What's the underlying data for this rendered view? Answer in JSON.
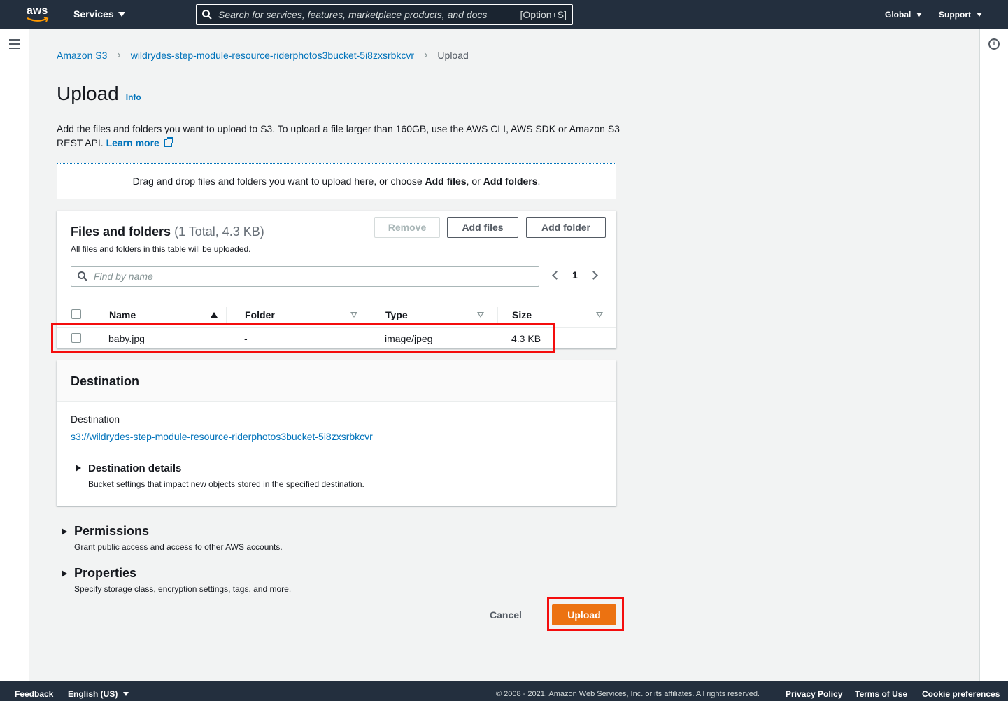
{
  "topnav": {
    "logo_text": "aws",
    "services_label": "Services",
    "search_placeholder": "Search for services, features, marketplace products, and docs",
    "search_shortcut": "[Option+S]",
    "region_label": "Global",
    "support_label": "Support"
  },
  "breadcrumb": {
    "root": "Amazon S3",
    "bucket": "wildrydes-step-module-resource-riderphotos3bucket-5i8zxsrbkcvr",
    "current": "Upload"
  },
  "page": {
    "title": "Upload",
    "info_link": "Info",
    "description": "Add the files and folders you want to upload to S3. To upload a file larger than 160GB, use the AWS CLI, AWS SDK or Amazon S3 REST API.",
    "learn_more": "Learn more"
  },
  "dropzone": {
    "prefix": "Drag and drop files and folders you want to upload here, or choose ",
    "add_files": "Add files",
    "middle": ", or ",
    "add_folders": "Add folders",
    "suffix": "."
  },
  "files": {
    "title": "Files and folders",
    "count": "(1 Total, 4.3 KB)",
    "subtitle": "All files and folders in this table will be uploaded.",
    "remove_label": "Remove",
    "add_files_label": "Add files",
    "add_folder_label": "Add folder",
    "filter_placeholder": "Find by name",
    "page_number": "1",
    "columns": [
      "Name",
      "Folder",
      "Type",
      "Size"
    ],
    "rows": [
      {
        "name": "baby.jpg",
        "folder": "-",
        "type": "image/jpeg",
        "size": "4.3 KB"
      }
    ]
  },
  "destination": {
    "title": "Destination",
    "label": "Destination",
    "uri": "s3://wildrydes-step-module-resource-riderphotos3bucket-5i8zxsrbkcvr",
    "details_title": "Destination details",
    "details_sub": "Bucket settings that impact new objects stored in the specified destination."
  },
  "permissions": {
    "title": "Permissions",
    "sub": "Grant public access and access to other AWS accounts."
  },
  "properties": {
    "title": "Properties",
    "sub": "Specify storage class, encryption settings, tags, and more."
  },
  "actions": {
    "cancel_label": "Cancel",
    "upload_label": "Upload"
  },
  "footer": {
    "feedback": "Feedback",
    "language": "English (US)",
    "copyright": "© 2008 - 2021, Amazon Web Services, Inc. or its affiliates. All rights reserved.",
    "privacy": "Privacy Policy",
    "terms": "Terms of Use",
    "cookies": "Cookie preferences"
  },
  "colors": {
    "nav_bg": "#232f3e",
    "link": "#0073bb",
    "primary_button": "#ec7211",
    "highlight_box": "#f40d0d"
  }
}
